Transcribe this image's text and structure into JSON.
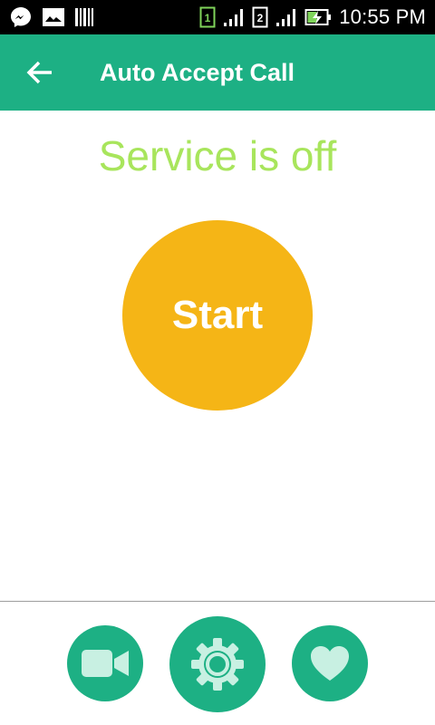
{
  "status_bar": {
    "left_icons": [
      "messenger-icon",
      "gallery-icon",
      "barcode-icon"
    ],
    "right_icons": [
      "sim1-icon",
      "signal-icon",
      "sim2-icon",
      "signal-icon",
      "battery-charging-icon"
    ],
    "sim1_label": "1",
    "sim2_label": "2",
    "time": "10:55 PM"
  },
  "app_bar": {
    "title": "Auto Accept Call",
    "back_icon": "arrow-left-icon",
    "color": "#1db084"
  },
  "main": {
    "status_text": "Service is off",
    "status_color": "#a8e55c",
    "start_label": "Start",
    "start_color": "#f5b516"
  },
  "bottom_nav": {
    "items": [
      {
        "icon": "video-camera-icon"
      },
      {
        "icon": "settings-gear-icon"
      },
      {
        "icon": "heart-icon"
      }
    ],
    "color": "#1db084",
    "icon_color": "#c8f0e2"
  }
}
